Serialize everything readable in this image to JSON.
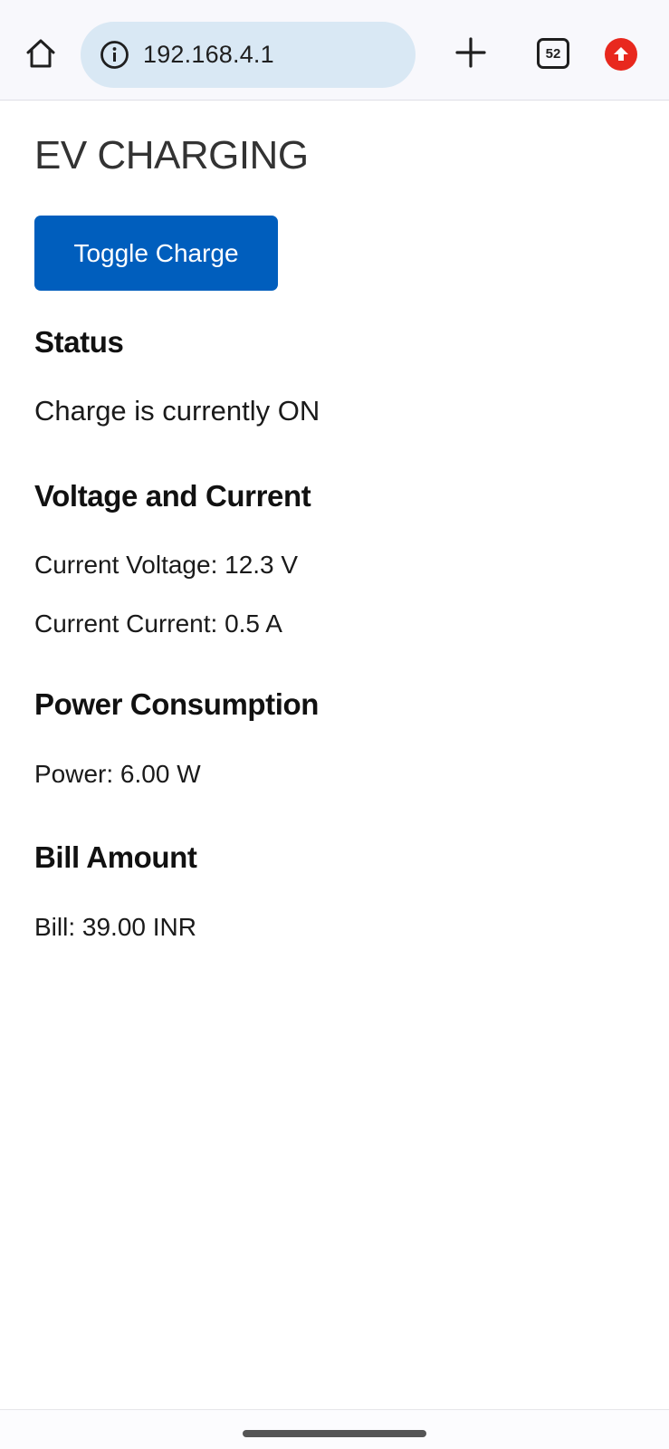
{
  "browser": {
    "url": "192.168.4.1",
    "tab_count": "52"
  },
  "page": {
    "title": "EV CHARGING",
    "toggle_button_label": "Toggle Charge",
    "status": {
      "heading": "Status",
      "text": "Charge is currently ON"
    },
    "voltage_current": {
      "heading": "Voltage and Current",
      "voltage_text": "Current Voltage: 12.3 V",
      "current_text": "Current Current: 0.5 A"
    },
    "power": {
      "heading": "Power Consumption",
      "text": "Power: 6.00 W"
    },
    "bill": {
      "heading": "Bill Amount",
      "text": "Bill: 39.00 INR"
    }
  },
  "icons": {
    "home": "home-icon",
    "info": "info-icon",
    "new_tab": "plus-icon",
    "update": "update-arrow-icon"
  },
  "colors": {
    "button_bg": "#005ebd",
    "omnibox_bg": "#d9e8f4",
    "update_badge": "#e8281e"
  }
}
